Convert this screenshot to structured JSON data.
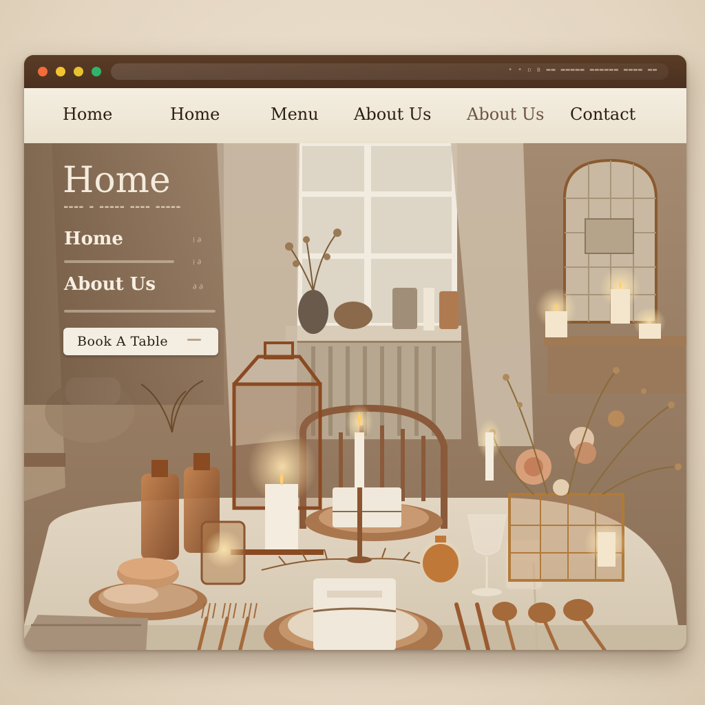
{
  "window": {
    "url_text": "• •  ᴅ ʙ  ▬▬  ▬▬▬▬▬ ▬▬▬▬▬▬ ▬▬▬▬ ▬▬"
  },
  "nav": {
    "items": [
      "Home",
      "Home",
      "Menu",
      "About Us",
      "About Us",
      "Contact"
    ]
  },
  "hero": {
    "title": "Home",
    "sidebar_items": [
      "Home",
      "About Us"
    ],
    "cta_label": "Book A Table"
  },
  "colors": {
    "dot_red": "#f26b3a",
    "dot_yellow": "#f4c430",
    "dot_yellow2": "#e8c22e",
    "dot_green": "#2fb56a",
    "accent_copper": "#b06a3a"
  },
  "icons": [
    "window-dot-icon",
    "candle-icon",
    "lantern-icon",
    "flower-icon",
    "fork-icon",
    "knife-icon",
    "spoon-icon"
  ]
}
